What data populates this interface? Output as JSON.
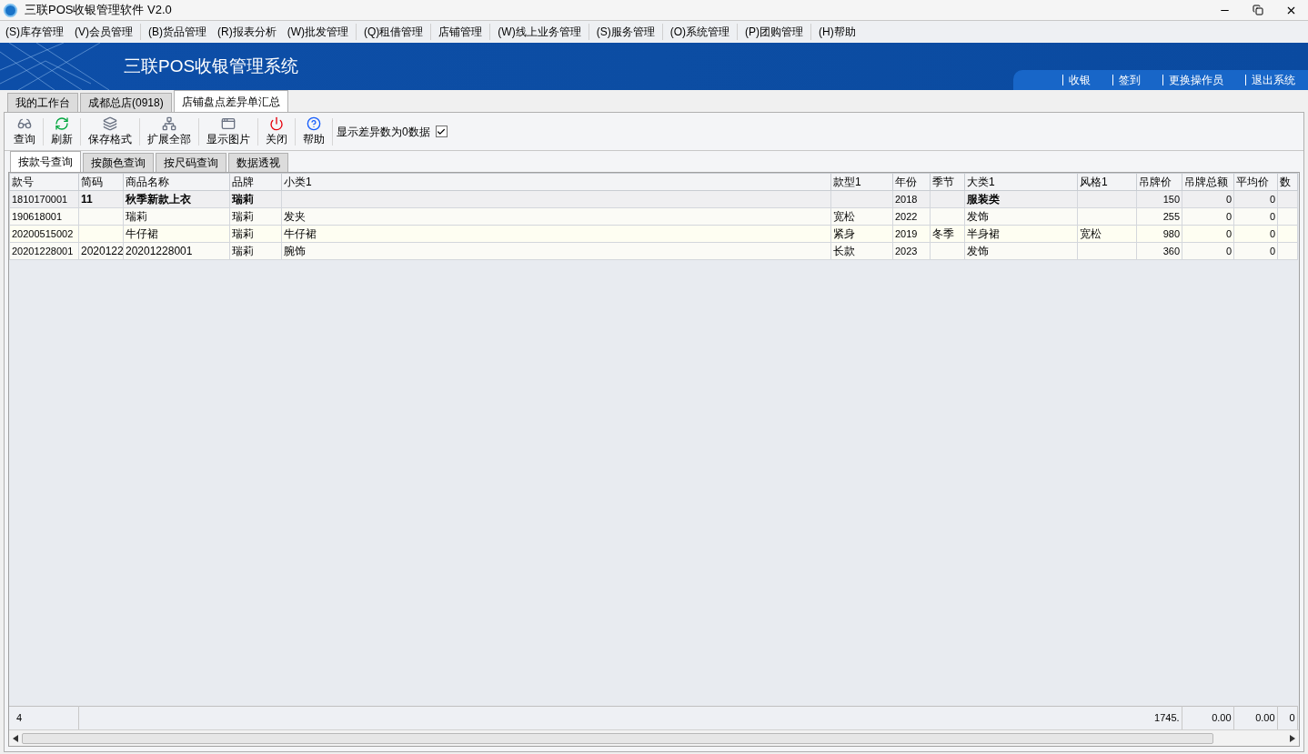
{
  "window": {
    "title": "三联POS收银管理软件 V2.0"
  },
  "menu": [
    "(S)库存管理",
    "(V)会员管理",
    "(B)货品管理",
    "(R)报表分析",
    "(W)批发管理",
    "(Q)租借管理",
    "店铺管理",
    "(W)线上业务管理",
    "(S)服务管理",
    "(O)系统管理",
    "(P)团购管理",
    "(H)帮助"
  ],
  "banner": {
    "title": "三联POS收银管理系统",
    "links": [
      "收银",
      "签到",
      "更换操作员",
      "退出系统"
    ]
  },
  "tabs": [
    {
      "label": "我的工作台",
      "selected": false
    },
    {
      "label": "成都总店(0918)",
      "selected": false
    },
    {
      "label": "店铺盘点差异单汇总",
      "selected": true
    }
  ],
  "toolbar": {
    "buttons": [
      "查询",
      "刷新",
      "保存格式",
      "扩展全部",
      "显示图片",
      "关闭",
      "帮助"
    ],
    "show_zero": {
      "label": "显示差异数为0数据",
      "checked": true
    }
  },
  "subtabs": [
    {
      "label": "按款号查询",
      "selected": true
    },
    {
      "label": "按颜色查询",
      "selected": false
    },
    {
      "label": "按尺码查询",
      "selected": false
    },
    {
      "label": "数据透视",
      "selected": false
    }
  ],
  "table": {
    "columns": [
      {
        "label": "款号",
        "kind": "text"
      },
      {
        "label": "简码",
        "kind": "text"
      },
      {
        "label": "商品名称",
        "kind": "text"
      },
      {
        "label": "品牌",
        "kind": "text"
      },
      {
        "label": "小类1",
        "kind": "text"
      },
      {
        "label": "款型1",
        "kind": "text"
      },
      {
        "label": "年份",
        "kind": "text"
      },
      {
        "label": "季节",
        "kind": "text"
      },
      {
        "label": "大类1",
        "kind": "text"
      },
      {
        "label": "风格1",
        "kind": "text"
      },
      {
        "label": "吊牌价",
        "kind": "number"
      },
      {
        "label": "吊牌总额",
        "kind": "number"
      },
      {
        "label": "平均价",
        "kind": "number"
      },
      {
        "label": "数",
        "kind": "number"
      }
    ],
    "rows": [
      {
        "selected": true,
        "cells": [
          "1810170001",
          "11",
          "秋季新款上衣",
          "瑞莉",
          "",
          "",
          "2018",
          "",
          "服装类",
          "",
          "150",
          "0",
          "0",
          ""
        ]
      },
      {
        "selected": false,
        "cells": [
          "190618001",
          "",
          "瑞莉",
          "瑞莉",
          "发夹",
          "宽松",
          "2022",
          "",
          "发饰",
          "",
          "255",
          "0",
          "0",
          ""
        ]
      },
      {
        "selected": false,
        "cells": [
          "20200515002",
          "",
          "牛仔裙",
          "瑞莉",
          "牛仔裙",
          "紧身",
          "2019",
          "冬季",
          "半身裙",
          "宽松",
          "980",
          "0",
          "0",
          ""
        ]
      },
      {
        "selected": false,
        "cells": [
          "20201228001",
          "2020122",
          "20201228001",
          "瑞莉",
          "腕饰",
          "长款",
          "2023",
          "",
          "发饰",
          "",
          "360",
          "0",
          "0",
          ""
        ]
      }
    ],
    "footer": {
      "count": "4",
      "totals": [
        "1745.",
        "0.00",
        "0.00",
        "0"
      ]
    }
  }
}
